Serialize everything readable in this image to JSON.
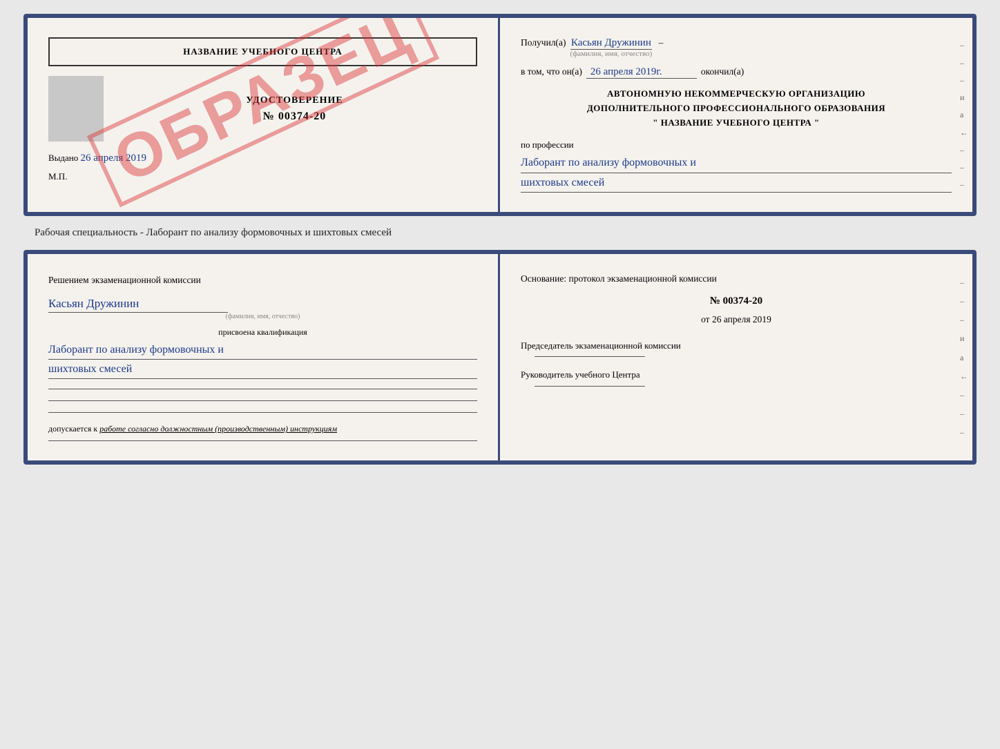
{
  "top_card": {
    "left": {
      "title": "НАЗВАНИЕ УЧЕБНОГО ЦЕНТРА",
      "obrazec": "ОБРАЗЕЦ",
      "udostoverenie_label": "УДОСТОВЕРЕНИЕ",
      "number": "№ 00374-20",
      "vydano_label": "Выдано",
      "vydano_date": "26 апреля 2019",
      "mp": "М.П."
    },
    "right": {
      "poluchil_label": "Получил(а)",
      "fio_handwritten": "Касьян Дружинин",
      "fio_sub": "(фамилия, имя, отчество)",
      "vtom_label": "в том, что он(а)",
      "date_handwritten": "26 апреля 2019г.",
      "okonchil_label": "окончил(а)",
      "org_line1": "АВТОНОМНУЮ НЕКОММЕРЧЕСКУЮ ОРГАНИЗАЦИЮ",
      "org_line2": "ДОПОЛНИТЕЛЬНОГО ПРОФЕССИОНАЛЬНОГО ОБРАЗОВАНИЯ",
      "org_line3": "\" НАЗВАНИЕ УЧЕБНОГО ЦЕНТРА \"",
      "profession_label": "по профессии",
      "profession_handwritten_line1": "Лаборант по анализу формовочных и",
      "profession_handwritten_line2": "шихтовых смесей",
      "side_dashes": [
        "-",
        "-",
        "-",
        "и",
        "а",
        "←",
        "-",
        "-",
        "-"
      ]
    }
  },
  "subtitle": "Рабочая специальность - Лаборант по анализу формовочных и шихтовых смесей",
  "bottom_card": {
    "left": {
      "heading": "Решением экзаменационной комиссии",
      "fio_handwritten": "Касьян Дружинин",
      "fio_sub": "(фамилия, имя, отчество)",
      "qualification_label": "присвоена квалификация",
      "qualification_line1": "Лаборант по анализу формовочных и",
      "qualification_line2": "шихтовых смесей",
      "dopusk_label": "допускается к",
      "dopusk_text": "работе согласно должностным (производственным) инструкциям"
    },
    "right": {
      "osnование": "Основание: протокол экзаменационной комиссии",
      "number": "№ 00374-20",
      "ot_label": "от",
      "date": "26 апреля 2019",
      "chairman_label": "Председатель экзаменационной комиссии",
      "rukovoditel_label": "Руководитель учебного Центра",
      "side_dashes": [
        "-",
        "-",
        "-",
        "и",
        "а",
        "←",
        "-",
        "-",
        "-"
      ]
    }
  }
}
